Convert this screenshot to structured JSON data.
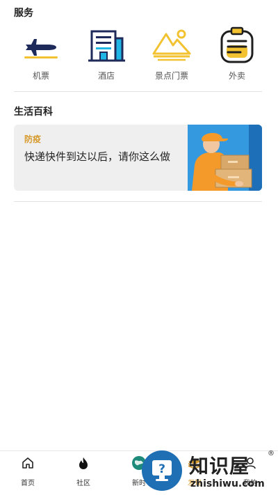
{
  "services": {
    "title": "服务",
    "items": [
      {
        "label": "机票",
        "icon": "airplane-icon"
      },
      {
        "label": "酒店",
        "icon": "hotel-building-icon"
      },
      {
        "label": "景点门票",
        "icon": "mountain-ticket-icon"
      },
      {
        "label": "外卖",
        "icon": "clipboard-takeout-icon"
      }
    ]
  },
  "life": {
    "title": "生活百科",
    "card": {
      "tag": "防疫",
      "text": "快递快件到达以后，请你这么做",
      "image": "delivery-person-with-boxes"
    }
  },
  "tabbar": {
    "items": [
      {
        "label": "首页",
        "icon": "home-icon"
      },
      {
        "label": "社区",
        "icon": "flame-icon"
      },
      {
        "label": "新时",
        "icon": "globe-icon"
      },
      {
        "label": "发现",
        "icon": "books-icon",
        "active": true
      },
      {
        "label": "我的",
        "icon": "user-icon"
      }
    ]
  },
  "watermark": {
    "brand": "知识屋",
    "domain": "zhishiwu.com",
    "mark": "®",
    "symbol": "?"
  },
  "colors": {
    "accent": "#d69a2d",
    "navy": "#1e2a5a",
    "cyan": "#1fb6e6",
    "gold": "#f2c230",
    "card_bg": "#efefef",
    "watermark_blue": "#1f6fb5"
  }
}
